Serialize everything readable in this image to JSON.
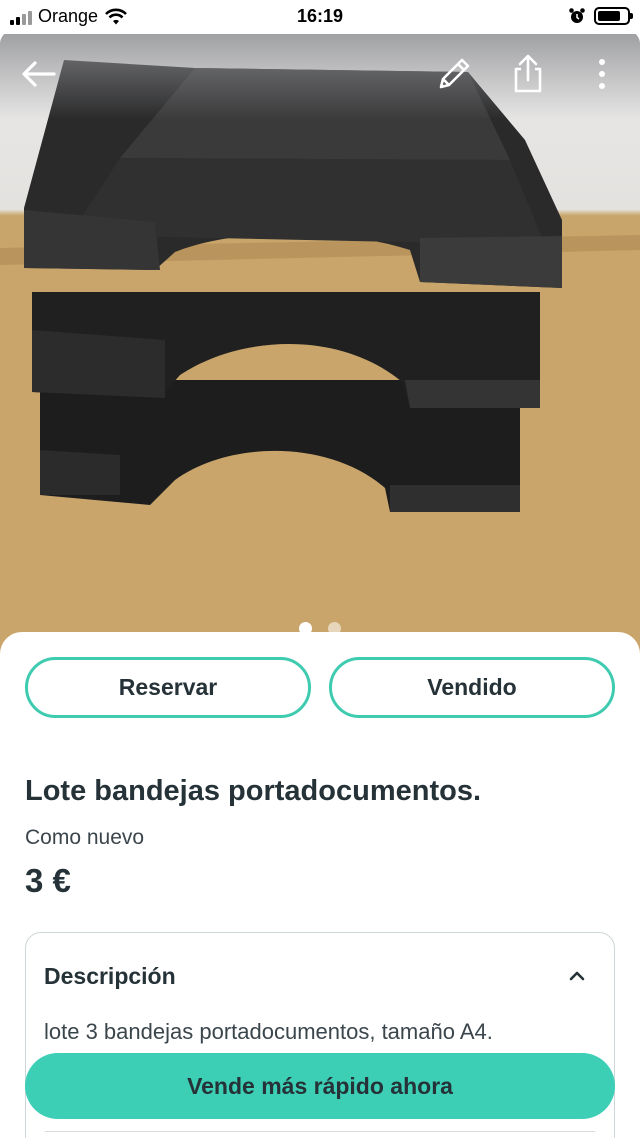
{
  "status_bar": {
    "carrier": "Orange",
    "time": "16:19",
    "icons": [
      "signal-icon",
      "wifi-icon",
      "alarm-icon",
      "battery-icon"
    ]
  },
  "header_actions": {
    "back_icon": "arrow-left-icon",
    "edit_icon": "pencil-icon",
    "share_icon": "share-icon",
    "more_icon": "more-vertical-icon"
  },
  "gallery": {
    "total_images": 2,
    "active_index": 1
  },
  "actions": {
    "reserve_label": "Reservar",
    "sold_label": "Vendido"
  },
  "product": {
    "title": "Lote bandejas portadocumentos.",
    "condition": "Como nuevo",
    "price": "3 €"
  },
  "description": {
    "heading": "Descripción",
    "text": "lote 3 bandejas portadocumentos, tamaño A4."
  },
  "cta": {
    "label": "Vende más rápido ahora"
  },
  "colors": {
    "accent": "#3dcfb5",
    "text": "#253238"
  }
}
